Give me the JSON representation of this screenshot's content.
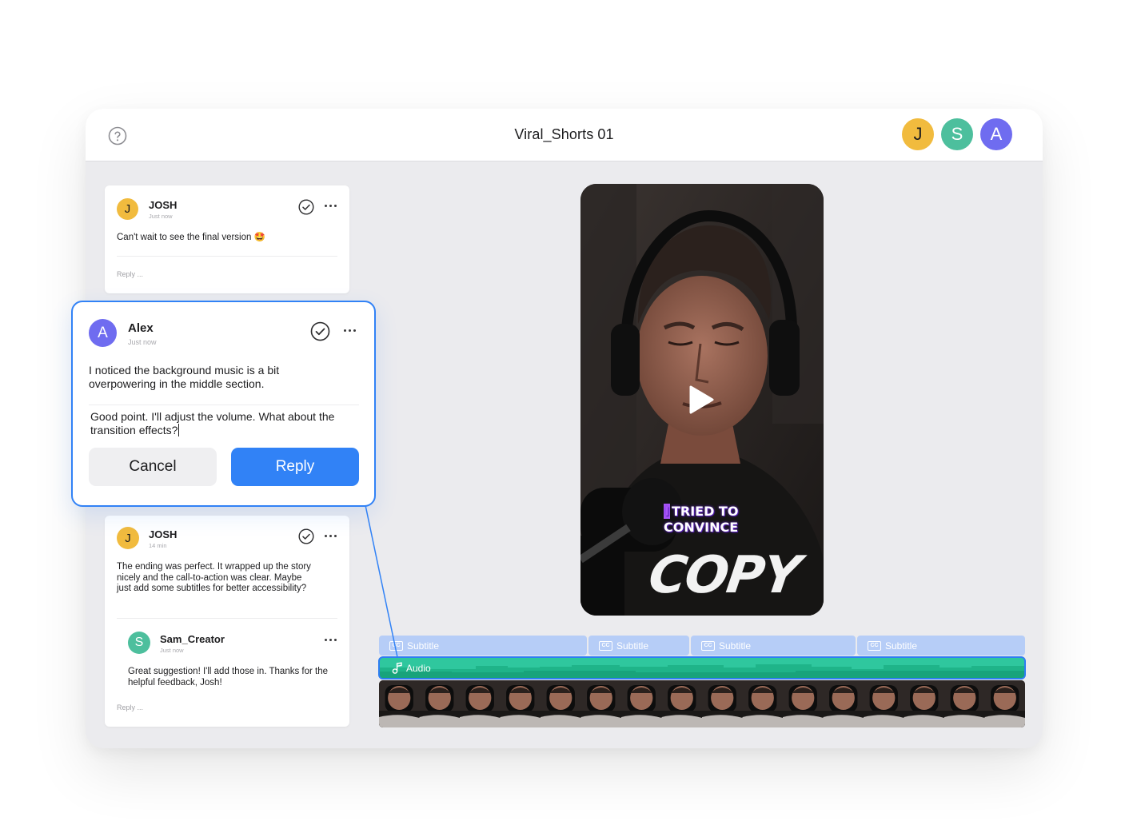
{
  "header": {
    "title": "Viral_Shorts 01",
    "help_icon": "help-circle-icon",
    "collaborators": [
      {
        "initial": "J",
        "color": "#f1bb3e"
      },
      {
        "initial": "S",
        "color": "#4dbf9d"
      },
      {
        "initial": "A",
        "color": "#6f6cf0"
      }
    ]
  },
  "comments": {
    "top": {
      "avatar_initial": "J",
      "author": "JOSH",
      "time": "Just now",
      "text": "Can't wait to see the final version 🤩",
      "reply_placeholder": "Reply ..."
    },
    "active": {
      "avatar_initial": "A",
      "author": "Alex",
      "time": "Just now",
      "text": "I noticed the background music is a bit overpowering in the middle section.",
      "draft_reply": "Good point. I'll adjust the volume. What about the transition effects?",
      "cancel_label": "Cancel",
      "reply_label": "Reply"
    },
    "bottom": {
      "avatar_initial": "J",
      "author": "JOSH",
      "time": "14 min",
      "text": "The ending was perfect. It wrapped up the story nicely and the call-to-action was clear. Maybe just add some subtitles for better accessibility?",
      "reply": {
        "avatar_initial": "S",
        "author": "Sam_Creator",
        "time": "Just now",
        "text": "Great suggestion! I'll add those in. Thanks for the helpful feedback, Josh!"
      },
      "reply_placeholder": "Reply ..."
    }
  },
  "video": {
    "caption_line1": "TRIED TO",
    "caption_line2": "CONVINCE",
    "shirt_text": "COPY",
    "play_icon": "play-icon"
  },
  "timeline": {
    "subtitle_label": "Subtitle",
    "subtitle_clip_count": 4,
    "cc_icon_text": "CC",
    "audio_label": "Audio",
    "audio_icon": "music-note-icon",
    "thumbnail_count": 16
  },
  "colors": {
    "accent": "#3182f6",
    "josh": "#f1bb3e",
    "sam": "#4dbf9d",
    "alex": "#6f6cf0",
    "audio": "#2fc79e",
    "subtitle": "#b6cdf7"
  }
}
